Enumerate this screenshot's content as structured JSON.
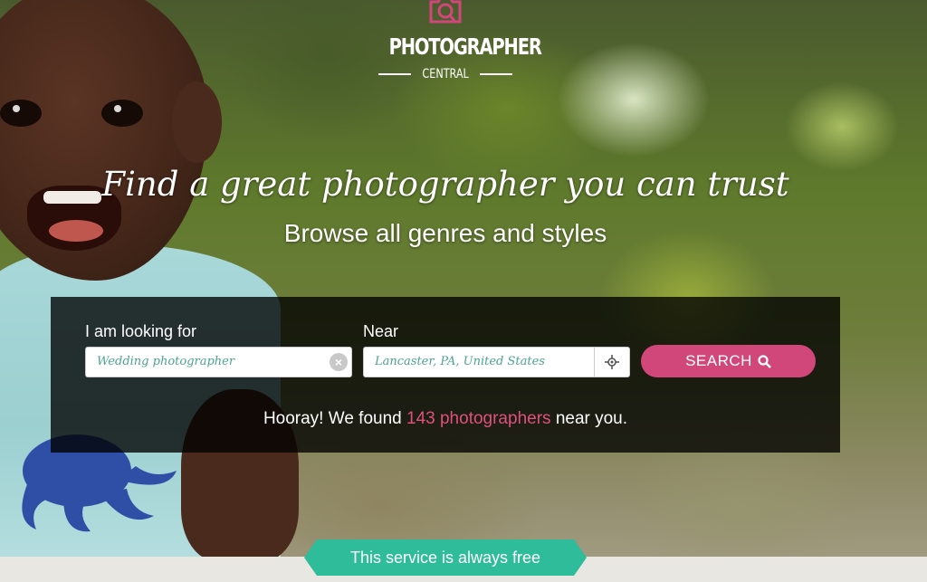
{
  "logo": {
    "name": "PHOTOGRAPHER",
    "sub": "CENTRAL",
    "accent": "#d1477a"
  },
  "hero": {
    "headline": "Find a great photographer you can trust",
    "subheadline": "Browse all genres and styles"
  },
  "search": {
    "looking_label": "I am looking for",
    "looking_value": "Wedding photographer",
    "near_label": "Near",
    "near_value": "Lancaster, PA, United States",
    "button_label": "SEARCH",
    "clear_icon": "clear-icon",
    "locate_icon": "crosshair-icon",
    "search_icon": "magnifier-icon"
  },
  "result": {
    "prefix": "Hooray! We found",
    "highlight": "143 photographers",
    "suffix": "near you."
  },
  "ribbon": {
    "text": "This service is always free",
    "color": "#2ebc9a"
  }
}
